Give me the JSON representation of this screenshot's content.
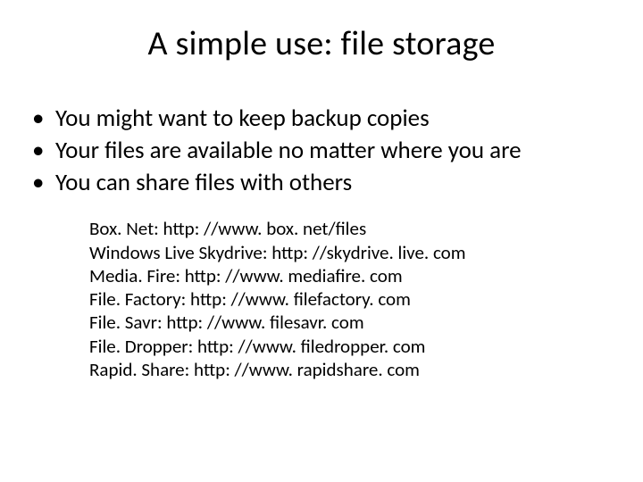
{
  "title": "A simple use: file storage",
  "bullets": [
    "You might want to keep backup copies",
    "Your files are available no matter where you are",
    "You can share files with others"
  ],
  "links": [
    "Box. Net: http: //www. box. net/files",
    "Windows Live Skydrive: http: //skydrive. live. com",
    "Media. Fire: http: //www. mediafire. com",
    "File. Factory: http: //www. filefactory. com",
    "File. Savr: http: //www. filesavr. com",
    "File. Dropper: http: //www. filedropper. com",
    "Rapid. Share: http: //www. rapidshare. com"
  ]
}
